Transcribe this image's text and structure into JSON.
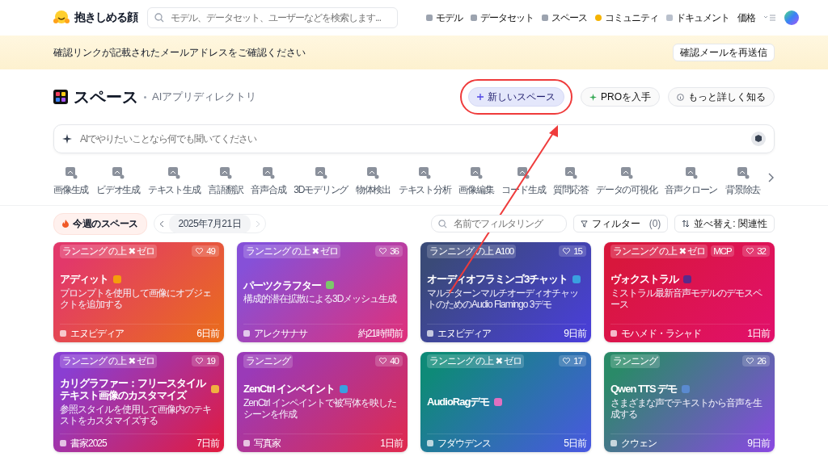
{
  "header": {
    "brand": "抱きしめる顔",
    "search": {
      "placeholder": "モデル、データセット、ユーザーなどを検索します..."
    },
    "nav": [
      {
        "label": "モデル"
      },
      {
        "label": "データセット"
      },
      {
        "label": "スペース"
      },
      {
        "label": "コミュニティ"
      },
      {
        "label": "ドキュメント"
      },
      {
        "label": "価格"
      }
    ]
  },
  "banner": {
    "message": "確認リンクが記載されたメールアドレスをご確認ください",
    "button": "確認メールを再送信"
  },
  "page": {
    "title": "スペース",
    "subtitle": "AIアプリディレクトリ",
    "actions": [
      {
        "label": "新しいスペース",
        "highlighted": true
      },
      {
        "label": "PROを入手",
        "highlighted": false
      },
      {
        "label": "もっと詳しく知る",
        "highlighted": false
      }
    ],
    "ai_search": {
      "placeholder": "AIでやりたいことなら何でも聞いてください"
    }
  },
  "categories": [
    "画像生成",
    "ビデオ生成",
    "テキスト生成",
    "言語翻訳",
    "音声合成",
    "3Dモデリング",
    "物体検出",
    "テキスト分析",
    "画像編集",
    "コード生成",
    "質問応答",
    "データの可視化",
    "音声クローン",
    "背景除去"
  ],
  "filters": {
    "trending": "今週のスペース",
    "date": "2025年7月21日",
    "filter_search": {
      "placeholder": "名前でフィルタリング"
    },
    "filter_button": "フィルター",
    "filter_count": "(0)",
    "sort": "並べ替え: 関連性"
  },
  "cards": [
    {
      "tags": [
        "ランニング の上 ✖ ゼロ"
      ],
      "likes": "49",
      "title": "アディット",
      "description": "プロンプトを使用して画像にオブジェクトを追加する",
      "author": "エヌビディア",
      "age": "6日前",
      "color": "#e2386a"
    },
    {
      "tags": [
        "ランニング の上 ✖ ゼロ"
      ],
      "likes": "36",
      "title": "パーツクラフター",
      "description": "構成的潜在拡散による3Dメッシュ生成",
      "author": "アレクサナサ",
      "age": "約21時間前",
      "color": "#8650d8"
    },
    {
      "tags": [
        "ランニング の上 A100"
      ],
      "likes": "15",
      "title": "オーディオフラミンゴ3チャット",
      "description": "マルチターンマルチオーディオチャットのためのAudio Flamingo 3デモ",
      "author": "エヌビディア",
      "age": "9日前",
      "color": "#3a4a78"
    },
    {
      "tags": [
        "ランニング の上 ✖ ゼロ",
        "MCP"
      ],
      "likes": "32",
      "title": "ヴォクストラル",
      "description": "ミストラル最新音声モデルのデモスペース",
      "author": "モハメド・ラシャド",
      "age": "1日前",
      "color": "#d8173c"
    },
    {
      "tags": [
        "ランニング の上 ✖ ゼロ"
      ],
      "likes": "19",
      "title": "カリグラファー：フリースタイルテキスト画像のカスタマイズ",
      "description": "参照スタイルを使用して画像内のテキストをカスタマイズする",
      "author": "書家2025",
      "age": "7日前",
      "color": "#8a3ed2"
    },
    {
      "tags": [
        "ランニング"
      ],
      "likes": "40",
      "title": "ZenCtrl インペイント",
      "description": "ZenCtrl インペイントで被写体を映したシーンを作成",
      "author": "写真家",
      "age": "1日前",
      "color": "#9a3ab8"
    },
    {
      "tags": [
        "ランニング の上 ✖ ゼロ"
      ],
      "likes": "17",
      "title": "AudioRagデモ",
      "author": "フダウデンス",
      "age": "5日前",
      "color": "#0e8a78"
    },
    {
      "tags": [
        "ランニング"
      ],
      "likes": "26",
      "title": "Qwen TTS デモ",
      "description": "さまざまな声でテキストから音声を生成する",
      "author": "クウェン",
      "age": "9日前",
      "color": "#2a8a68"
    }
  ]
}
